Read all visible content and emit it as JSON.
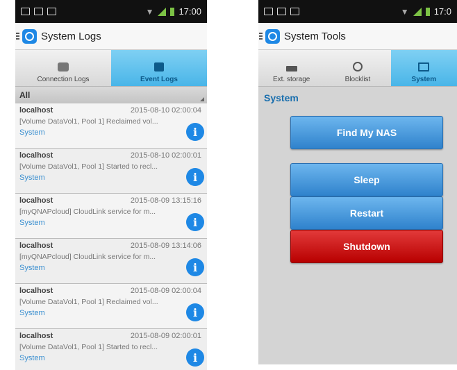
{
  "left": {
    "status": {
      "time": "17:00"
    },
    "title": "System Logs",
    "tabs": [
      {
        "label": "Connection Logs",
        "active": false
      },
      {
        "label": "Event Logs",
        "active": true
      }
    ],
    "filter": "All",
    "logs": [
      {
        "host": "localhost",
        "time": "2015-08-10 02:00:04",
        "message": "[Volume DataVol1, Pool 1] Reclaimed vol...",
        "category": "System"
      },
      {
        "host": "localhost",
        "time": "2015-08-10 02:00:01",
        "message": "[Volume DataVol1, Pool 1] Started to recl...",
        "category": "System"
      },
      {
        "host": "localhost",
        "time": "2015-08-09 13:15:16",
        "message": "[myQNAPcloud] CloudLink service for m...",
        "category": "System"
      },
      {
        "host": "localhost",
        "time": "2015-08-09 13:14:06",
        "message": "[myQNAPcloud] CloudLink service for m...",
        "category": "System"
      },
      {
        "host": "localhost",
        "time": "2015-08-09 02:00:04",
        "message": "[Volume DataVol1, Pool 1] Reclaimed vol...",
        "category": "System"
      },
      {
        "host": "localhost",
        "time": "2015-08-09 02:00:01",
        "message": "[Volume DataVol1, Pool 1] Started to recl...",
        "category": "System"
      }
    ]
  },
  "right": {
    "status": {
      "time": "17:0"
    },
    "title": "System Tools",
    "tabs": [
      {
        "label": "Ext. storage",
        "active": false
      },
      {
        "label": "Blocklist",
        "active": false
      },
      {
        "label": "System",
        "active": true
      }
    ],
    "section": "System",
    "buttons": {
      "find": "Find My NAS",
      "sleep": "Sleep",
      "restart": "Restart",
      "shutdown": "Shutdown"
    }
  },
  "colors": {
    "accent": "#1e88e5",
    "tab_active": "#49b5e8",
    "danger": "#c40000"
  }
}
